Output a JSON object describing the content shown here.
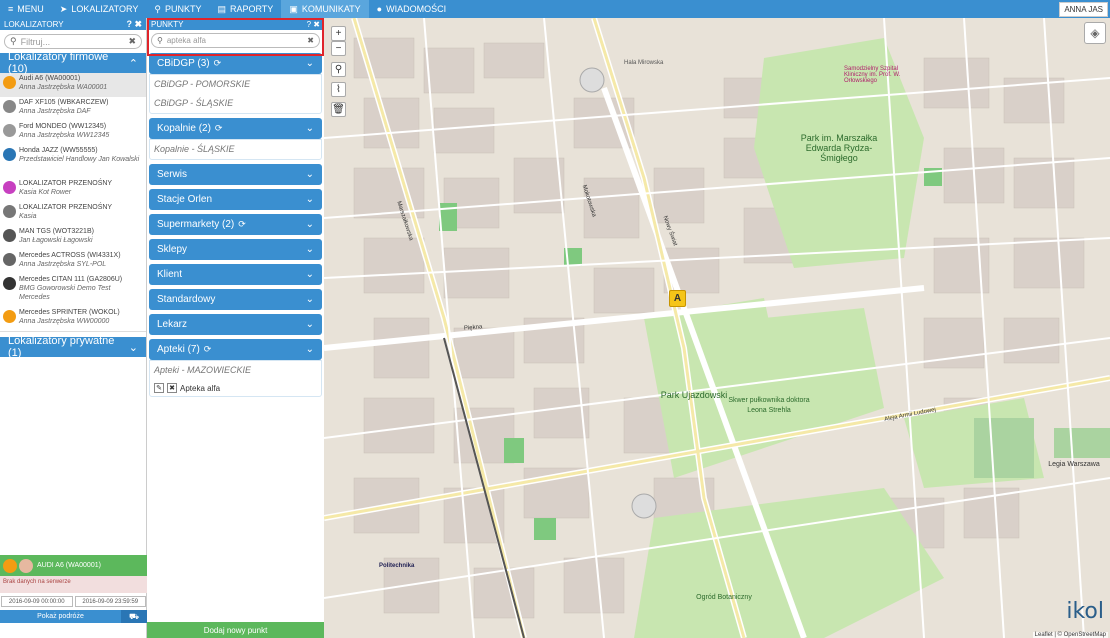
{
  "topbar": {
    "items": [
      {
        "label": "Menu",
        "icon": "≡"
      },
      {
        "label": "Lokalizatory",
        "icon": "➤"
      },
      {
        "label": "Punkty",
        "icon": "⚲"
      },
      {
        "label": "Raporty",
        "icon": "▤"
      },
      {
        "label": "Komunikaty",
        "icon": "▣"
      },
      {
        "label": "Wiadomości",
        "icon": "●"
      }
    ],
    "user": "ANNA JAS"
  },
  "left": {
    "title": "LOKALIZATORY",
    "controls": "? ✖",
    "filter_placeholder": "Filtruj...",
    "company_group": "Lokalizatory firmowe (10)",
    "private_group": "Lokalizatory prywatne (1)",
    "locators": [
      {
        "name": "Audi A6 (WA00001)",
        "sub": "Anna Jastrzębska WA00001",
        "color": "#f39c12"
      },
      {
        "name": "DAF XF105 (WBKARCZEW)",
        "sub": "Anna Jastrzębska DAF",
        "color": "#888"
      },
      {
        "name": "Ford MONDEO (WW12345)",
        "sub": "Anna Jastrzębska WW12345",
        "color": "#999"
      },
      {
        "name": "Honda JAZZ (WW55555)",
        "sub": "Przedstawiciel Handlowy Jan Kowalski",
        "color": "#2a76b5"
      },
      {
        "name": "LOKALIZATOR PRZENOŚNY",
        "sub": "Kasia Kot Rower",
        "color": "#c740c0"
      },
      {
        "name": "LOKALIZATOR PRZENOŚNY",
        "sub": "Kasia",
        "color": "#777"
      },
      {
        "name": "MAN TGS (WOT3221B)",
        "sub": "Jan Łagowski Łagowski",
        "color": "#555"
      },
      {
        "name": "Mercedes ACTROSS (WI4331X)",
        "sub": "Anna Jastrzębska SYL-POL",
        "color": "#666"
      },
      {
        "name": "Mercedes CITAN 111 (GA2806U)",
        "sub": "BMG Goworowski Demo Test Mercedes",
        "color": "#333"
      },
      {
        "name": "Mercedes SPRINTER (WOKOL)",
        "sub": "Anna Jastrzębska WW00000",
        "color": "#f39c12"
      }
    ],
    "selected": "AUDI A6 (WA00001)",
    "error": "Brak danych na serwerze",
    "date_from": "2016-09-09 00:00:00",
    "date_to": "2016-09-09 23:59:59",
    "route_button": "Pokaż podróże"
  },
  "points": {
    "title": "PUNKTY",
    "controls": "? ✖",
    "search_value": "apteka alfa",
    "categories": [
      {
        "label": "CBiDGP (3)",
        "refresh": true,
        "subs": [
          "CBiDGP - POMORSKIE",
          "CBiDGP - ŚLĄSKIE"
        ]
      },
      {
        "label": "Kopalnie (2)",
        "refresh": true,
        "subs": [
          "Kopalnie - ŚLĄSKIE"
        ]
      },
      {
        "label": "Serwis",
        "refresh": false,
        "subs": []
      },
      {
        "label": "Stacje Orlen",
        "refresh": false,
        "subs": []
      },
      {
        "label": "Supermarkety (2)",
        "refresh": true,
        "subs": []
      },
      {
        "label": "Sklepy",
        "refresh": false,
        "subs": []
      },
      {
        "label": "Klient",
        "refresh": false,
        "subs": []
      },
      {
        "label": "Standardowy",
        "refresh": false,
        "subs": []
      },
      {
        "label": "Lekarz",
        "refresh": false,
        "subs": []
      },
      {
        "label": "Apteki (7)",
        "refresh": true,
        "subs": [
          "Apteki - MAZOWIECKIE"
        ]
      }
    ],
    "apteka_item": "Apteka alfa",
    "add_button": "Dodaj nowy punkt"
  },
  "map": {
    "zoom_in": "+",
    "zoom_out": "−",
    "labels": {
      "park1": "Park im. Marszałka Edwarda Rydza-Śmigłego",
      "park2": "Park Ujazdowski",
      "park3": "Skwer pułkownika doktora Leona Strehla",
      "garden": "Ogród Botaniczny",
      "legia": "Legia Warszawa",
      "politechnika": "Politechnika",
      "hospital": "Samodzielny Szpital Kliniczny im. Prof. W. Orłowskiego",
      "hala": "Hala Mirowska",
      "street1": "Aleja Armii Ludowej",
      "street2": "Nowy Świat",
      "street3": "Marszałkowska",
      "street4": "Piękna",
      "street5": "Mokotowska"
    },
    "marker_letter": "A",
    "logo": "ikol",
    "attribution": "Leaflet | © OpenStreetMap"
  }
}
